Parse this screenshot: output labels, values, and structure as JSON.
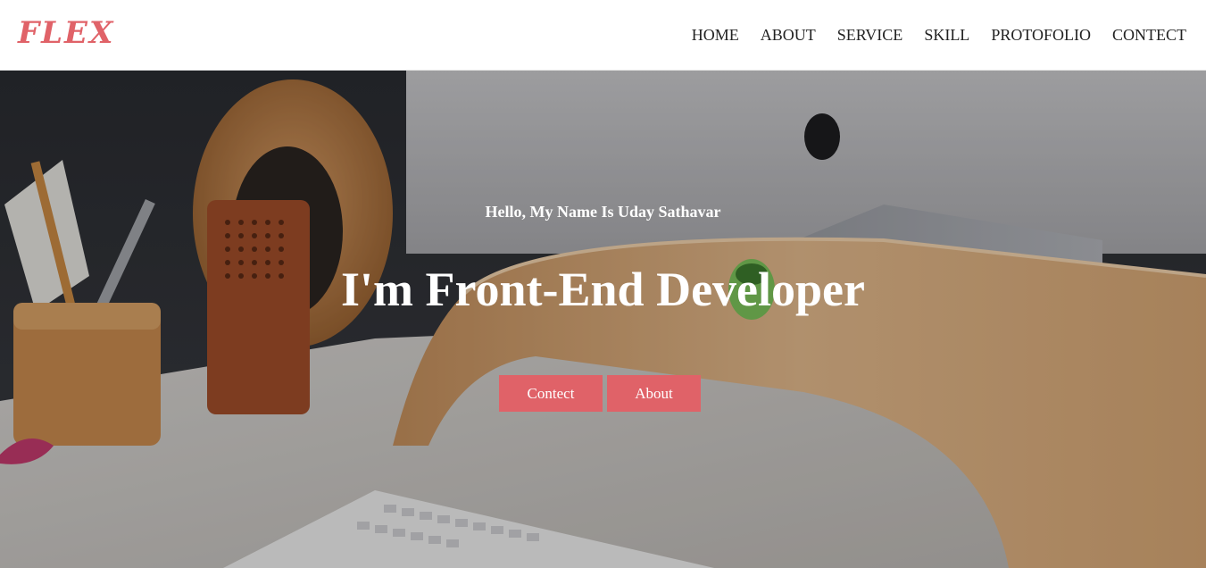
{
  "brand": {
    "logo_text": "FLEX",
    "accent_color": "#e06268"
  },
  "nav": {
    "items": [
      {
        "label": "HOME"
      },
      {
        "label": "ABOUT"
      },
      {
        "label": "SERVICE"
      },
      {
        "label": "SKILL"
      },
      {
        "label": "PROTOFOLIO"
      },
      {
        "label": "CONTECT"
      }
    ]
  },
  "hero": {
    "greeting": "Hello, My Name Is Uday Sathavar",
    "headline": "I'm Front-End Developer",
    "buttons": {
      "contact_label": "Contect",
      "about_label": "About"
    },
    "background_image": "desk-with-imac-photo"
  }
}
